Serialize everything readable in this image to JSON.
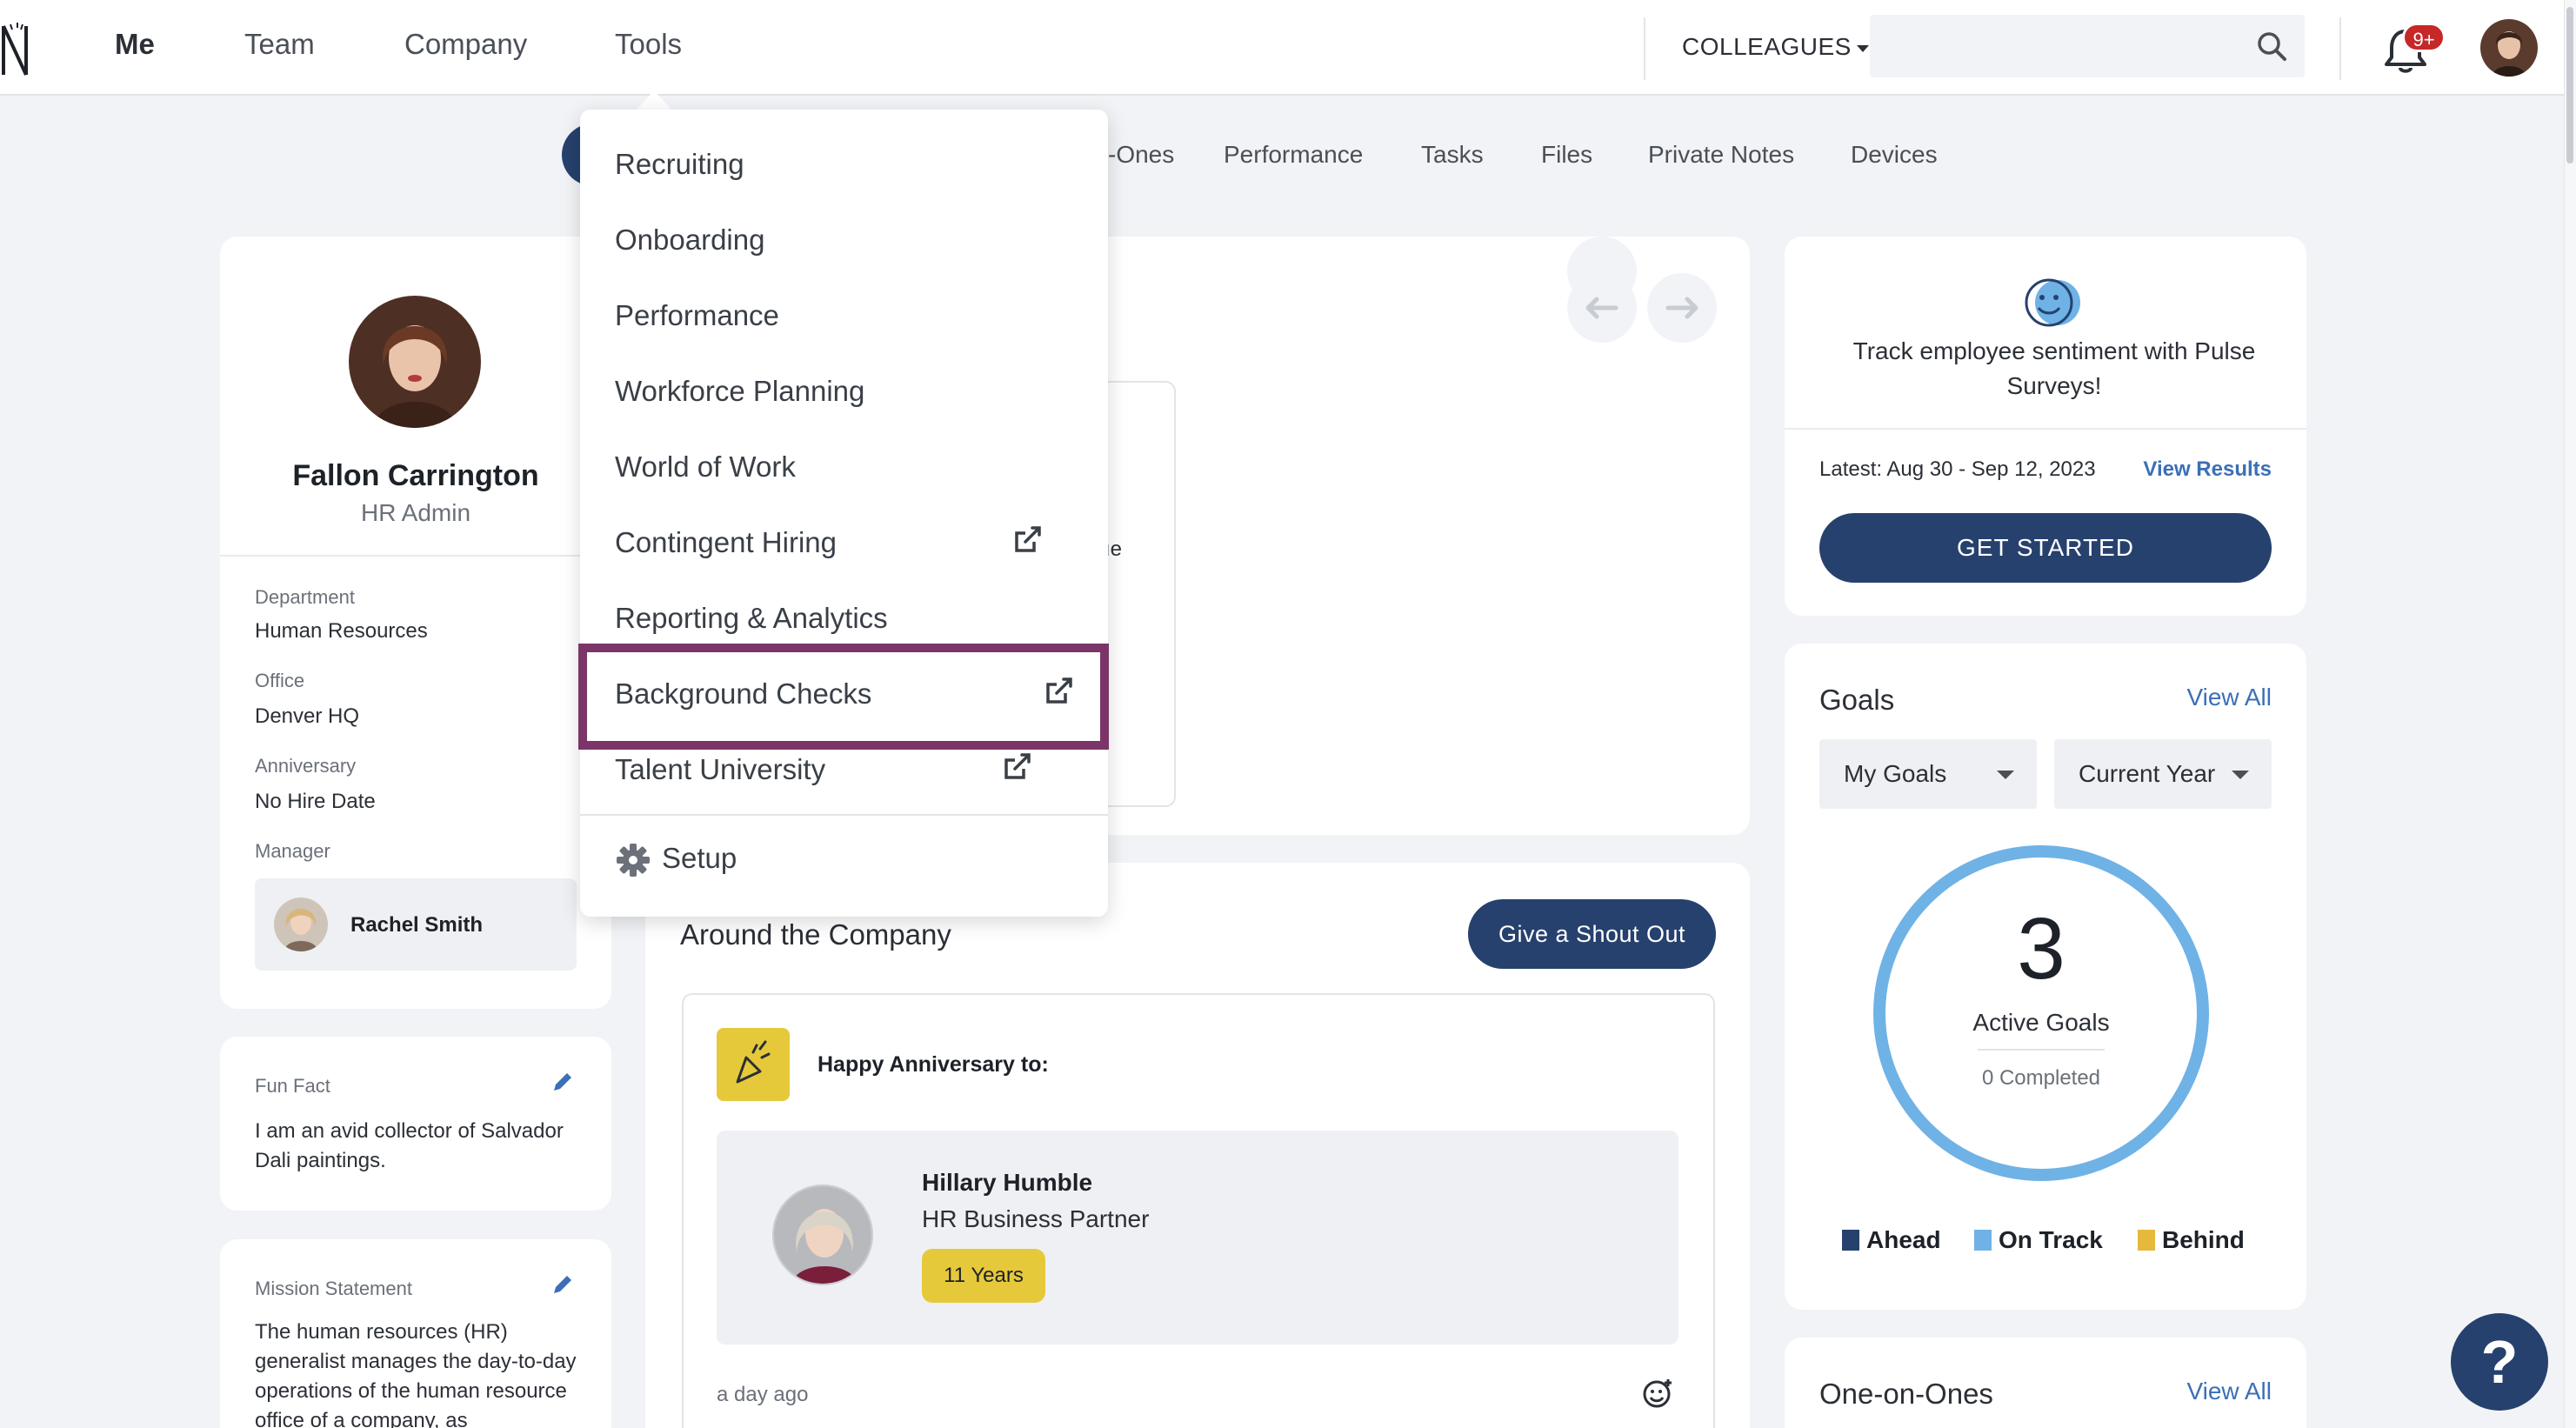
{
  "nav": {
    "items": [
      "Me",
      "Team",
      "Company",
      "Tools"
    ],
    "colleagues_label": "COLLEAGUES",
    "search_placeholder": "",
    "notification_badge": "9+"
  },
  "subtabs": [
    "-Ones",
    "Performance",
    "Tasks",
    "Files",
    "Private Notes",
    "Devices"
  ],
  "profile": {
    "name": "Fallon Carrington",
    "role": "HR Admin",
    "department_label": "Department",
    "department": "Human Resources",
    "office_label": "Office",
    "office": "Denver HQ",
    "anniversary_label": "Anniversary",
    "anniversary": "No Hire Date",
    "manager_label": "Manager",
    "manager_name": "Rachel Smith"
  },
  "fun_fact": {
    "label": "Fun Fact",
    "text": "I am an avid collector of Salvador Dali paintings."
  },
  "mission": {
    "label": "Mission Statement",
    "text": "The human resources (HR) generalist manages the day-to-day operations of the human resource office of a company, as"
  },
  "partial_text": "ıe",
  "around_company": {
    "title": "Around the Company",
    "shout_button": "Give a Shout Out",
    "anniversary_title": "Happy Anniversary to:",
    "person_name": "Hillary Humble",
    "person_role": "HR Business Partner",
    "years_badge": "11 Years",
    "time_ago": "a day ago"
  },
  "pulse": {
    "text": "Track employee sentiment with Pulse Surveys!",
    "latest": "Latest: Aug 30 - Sep 12, 2023",
    "view_results": "View Results",
    "button": "GET STARTED"
  },
  "goals": {
    "title": "Goals",
    "view_all": "View All",
    "filter_scope": "My Goals",
    "filter_period": "Current Year",
    "active_count": "3",
    "active_label": "Active Goals",
    "completed_label": "0 Completed",
    "legend": [
      {
        "label": "Ahead",
        "color": "#26416d"
      },
      {
        "label": "On Track",
        "color": "#6fb2e6"
      },
      {
        "label": "Behind",
        "color": "#e6b83b"
      }
    ]
  },
  "one_on_ones": {
    "title": "One-on-Ones",
    "view_all": "View All"
  },
  "tools_menu": {
    "items": [
      {
        "label": "Recruiting",
        "external": false
      },
      {
        "label": "Onboarding",
        "external": false
      },
      {
        "label": "Performance",
        "external": false
      },
      {
        "label": "Workforce Planning",
        "external": false
      },
      {
        "label": "World of Work",
        "external": false
      },
      {
        "label": "Contingent Hiring",
        "external": true
      },
      {
        "label": "Reporting & Analytics",
        "external": false
      },
      {
        "label": "Background Checks",
        "external": true
      },
      {
        "label": "Talent University",
        "external": true
      }
    ],
    "setup_label": "Setup",
    "highlighted_item": "Background Checks"
  },
  "colors": {
    "primary": "#26416d",
    "accent_link": "#3b6fb6",
    "highlight": "#7b3569",
    "badge_yellow": "#e6c93b",
    "goal_ring": "#6fb2e6"
  },
  "help_label": "?"
}
